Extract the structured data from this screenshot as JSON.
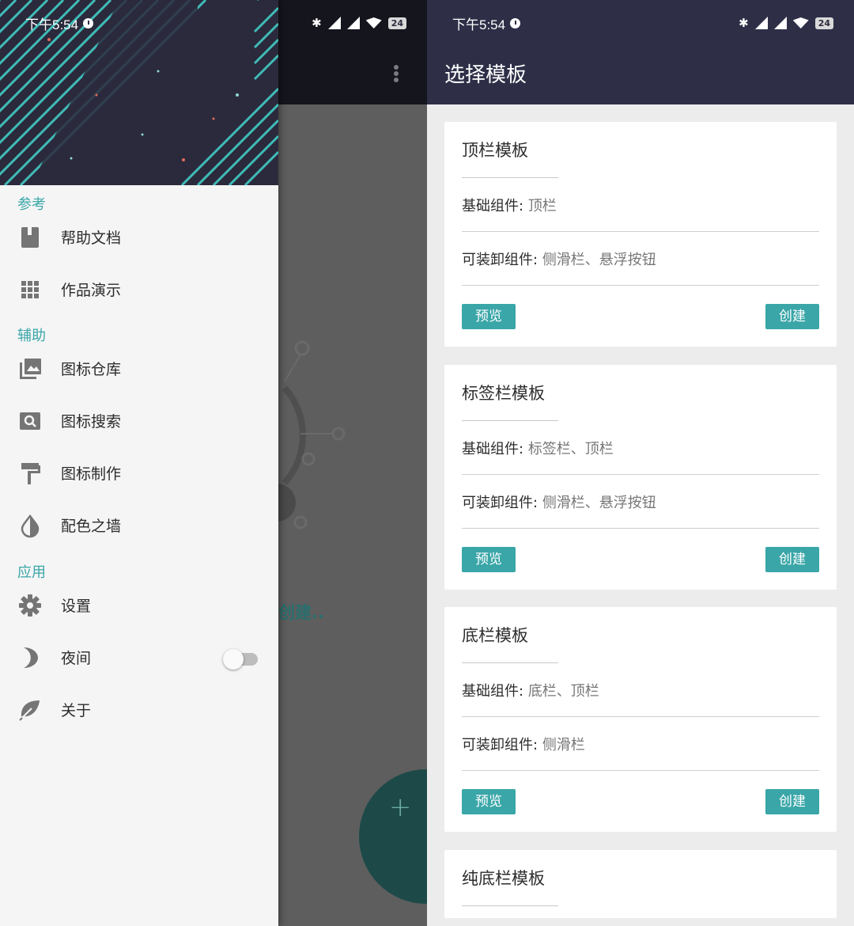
{
  "status_bar": {
    "time": "下午5:54",
    "battery": "24"
  },
  "left": {
    "content_text": "创建..",
    "fab_symbol": "+",
    "drawer": {
      "sections": [
        {
          "title": "参考",
          "items": [
            {
              "label": "帮助文档",
              "icon": "book-icon"
            },
            {
              "label": "作品演示",
              "icon": "grid-icon"
            }
          ]
        },
        {
          "title": "辅助",
          "items": [
            {
              "label": "图标仓库",
              "icon": "photo-library-icon"
            },
            {
              "label": "图标搜索",
              "icon": "image-search-icon"
            },
            {
              "label": "图标制作",
              "icon": "paint-roller-icon"
            },
            {
              "label": "配色之墙",
              "icon": "contrast-drop-icon"
            }
          ]
        },
        {
          "title": "应用",
          "items": [
            {
              "label": "设置",
              "icon": "gear-icon"
            },
            {
              "label": "夜间",
              "icon": "moon-icon",
              "toggle": false
            },
            {
              "label": "关于",
              "icon": "leaf-icon"
            }
          ]
        }
      ]
    }
  },
  "right": {
    "title": "选择模板",
    "base_label": "基础组件:",
    "optional_label": "可装卸组件:",
    "preview_label": "预览",
    "create_label": "创建",
    "templates": [
      {
        "name": "顶栏模板",
        "base": "顶栏",
        "optional": "侧滑栏、悬浮按钮"
      },
      {
        "name": "标签栏模板",
        "base": "标签栏、顶栏",
        "optional": "侧滑栏、悬浮按钮"
      },
      {
        "name": "底栏模板",
        "base": "底栏、顶栏",
        "optional": "侧滑栏"
      },
      {
        "name": "纯底栏模板"
      }
    ]
  },
  "colors": {
    "accent": "#3aa6a8",
    "appbar_dark": "#2e2f47",
    "drawer_bg": "#f5f5f5"
  }
}
